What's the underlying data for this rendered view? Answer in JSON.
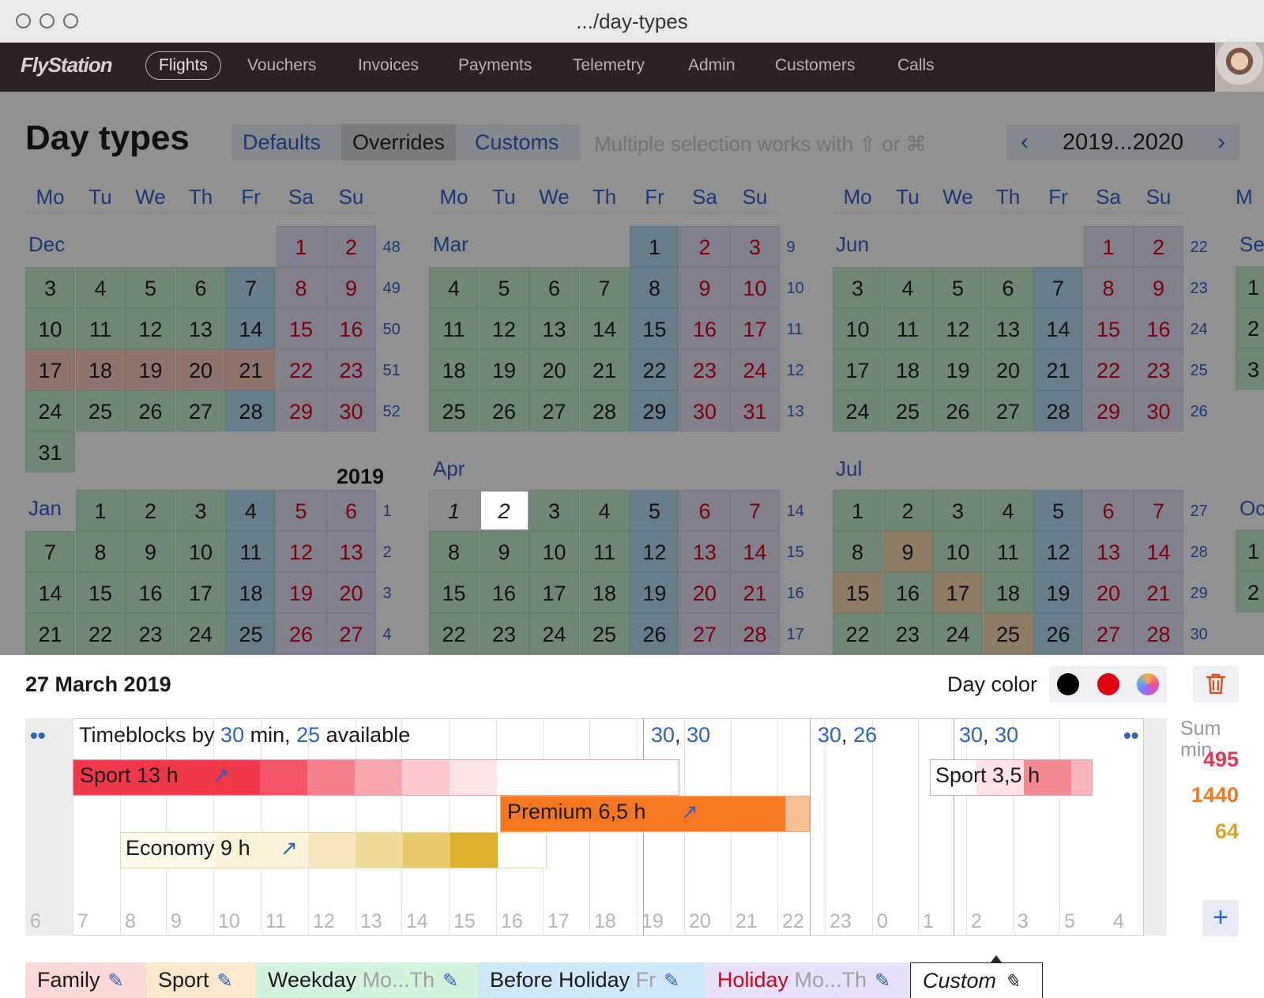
{
  "window": {
    "title": ".../day-types"
  },
  "nav": {
    "logo": "FlyStation",
    "items": [
      {
        "label": "Flights",
        "active": true
      },
      {
        "label": "Vouchers"
      },
      {
        "label": "Invoices"
      },
      {
        "label": "Payments"
      },
      {
        "label": "Telemetry"
      },
      {
        "label": "Admin"
      },
      {
        "label": "Customers"
      },
      {
        "label": "Calls"
      }
    ]
  },
  "page": {
    "title": "Day types",
    "tabs": [
      "Defaults",
      "Overrides",
      "Customs"
    ],
    "selected_tab": "Overrides",
    "hint": "Multiple selection works with ⇧ or ⌘",
    "year_range": "2019...2020",
    "prev_icon": "chevron-left-icon",
    "next_icon": "chevron-right-icon"
  },
  "calendar": {
    "weekdays": [
      "Mo",
      "Tu",
      "We",
      "Th",
      "Fr",
      "Sa",
      "Su"
    ],
    "year_label": "2019",
    "months": [
      "Dec",
      "Mar",
      "Jun",
      "Se",
      "Jan",
      "Apr",
      "Jul",
      "Oc"
    ],
    "col1": {
      "dec": {
        "rows": [
          [
            "",
            "",
            "",
            "",
            "",
            "1",
            "2"
          ],
          [
            "3",
            "4",
            "5",
            "6",
            "7",
            "8",
            "9"
          ],
          [
            "10",
            "11",
            "12",
            "13",
            "14",
            "15",
            "16"
          ],
          [
            "17",
            "18",
            "19",
            "20",
            "21",
            "22",
            "23"
          ],
          [
            "24",
            "25",
            "26",
            "27",
            "28",
            "29",
            "30"
          ],
          [
            "31",
            "",
            "",
            "",
            "",
            "",
            ""
          ]
        ],
        "weeks": [
          "48",
          "49",
          "50",
          "51",
          "52"
        ]
      },
      "jan": {
        "rows": [
          [
            "",
            "1",
            "2",
            "3",
            "4",
            "5",
            "6"
          ],
          [
            "7",
            "8",
            "9",
            "10",
            "11",
            "12",
            "13"
          ],
          [
            "14",
            "15",
            "16",
            "17",
            "18",
            "19",
            "20"
          ],
          [
            "21",
            "22",
            "23",
            "24",
            "25",
            "26",
            "27"
          ]
        ],
        "weeks": [
          "1",
          "2",
          "3",
          "4"
        ]
      }
    },
    "col2": {
      "mar": {
        "rows": [
          [
            "",
            "",
            "",
            "",
            "1",
            "2",
            "3"
          ],
          [
            "4",
            "5",
            "6",
            "7",
            "8",
            "9",
            "10"
          ],
          [
            "11",
            "12",
            "13",
            "14",
            "15",
            "16",
            "17"
          ],
          [
            "18",
            "19",
            "20",
            "21",
            "22",
            "23",
            "24"
          ],
          [
            "25",
            "26",
            "27",
            "28",
            "29",
            "30",
            "31"
          ]
        ],
        "weeks": [
          "9",
          "10",
          "11",
          "12",
          "13"
        ]
      },
      "apr": {
        "rows": [
          [
            "1",
            "2",
            "3",
            "4",
            "5",
            "6",
            "7"
          ],
          [
            "8",
            "9",
            "10",
            "11",
            "12",
            "13",
            "14"
          ],
          [
            "15",
            "16",
            "17",
            "18",
            "19",
            "20",
            "21"
          ],
          [
            "22",
            "23",
            "24",
            "25",
            "26",
            "27",
            "28"
          ]
        ],
        "weeks": [
          "14",
          "15",
          "16",
          "17"
        ]
      }
    },
    "col3": {
      "jun": {
        "rows": [
          [
            "",
            "",
            "",
            "",
            "",
            "1",
            "2"
          ],
          [
            "3",
            "4",
            "5",
            "6",
            "7",
            "8",
            "9"
          ],
          [
            "10",
            "11",
            "12",
            "13",
            "14",
            "15",
            "16"
          ],
          [
            "17",
            "18",
            "19",
            "20",
            "21",
            "22",
            "23"
          ],
          [
            "24",
            "25",
            "26",
            "27",
            "28",
            "29",
            "30"
          ]
        ],
        "weeks": [
          "22",
          "23",
          "24",
          "25",
          "26"
        ]
      },
      "jul": {
        "rows": [
          [
            "1",
            "2",
            "3",
            "4",
            "5",
            "6",
            "7"
          ],
          [
            "8",
            "9",
            "10",
            "11",
            "12",
            "13",
            "14"
          ],
          [
            "15",
            "16",
            "17",
            "18",
            "19",
            "20",
            "21"
          ],
          [
            "22",
            "23",
            "24",
            "25",
            "26",
            "27",
            "28"
          ]
        ],
        "weeks": [
          "27",
          "28",
          "29",
          "30"
        ]
      }
    },
    "col4_partial": [
      "1",
      "2",
      "3",
      "1",
      "2"
    ]
  },
  "editor": {
    "date": "27 March 2019",
    "day_color_label": "Day color",
    "colors": [
      "#000000",
      "#e0000f",
      "gradient"
    ],
    "trash_icon": "trash-icon",
    "timeblocks": {
      "prefix": "Timeblocks by ",
      "by": "30",
      "mid": " min, ",
      "available": "25",
      "suffix": " available"
    },
    "groups": [
      {
        "a": "30",
        "b": "30"
      },
      {
        "a": "30",
        "b": "26"
      },
      {
        "a": "30",
        "b": "30"
      }
    ],
    "comma": ", ",
    "dots": "••",
    "hours": [
      "6",
      "7",
      "8",
      "9",
      "10",
      "11",
      "12",
      "13",
      "14",
      "15",
      "16",
      "17",
      "18",
      "19",
      "20",
      "21",
      "22",
      "23",
      "0",
      "1",
      "2",
      "3",
      "5",
      "4"
    ],
    "bars": [
      {
        "label": "Sport 13 h",
        "color": "#f0384a"
      },
      {
        "label": "Premium 6,5 h",
        "color": "#f5771f"
      },
      {
        "label": "Economy 9 h",
        "color": "#dcae2a"
      },
      {
        "label": "Sport 3,5 h",
        "color": "#f0384a"
      }
    ],
    "ext_icon": "↗",
    "sum_label": "Sum min",
    "sums": [
      {
        "value": "495",
        "color": "#e8394a"
      },
      {
        "value": "1440",
        "color": "#f07a1c"
      },
      {
        "value": "64",
        "color": "#d8a520"
      }
    ],
    "add_label": "+"
  },
  "legend": [
    {
      "label": "Family",
      "sub": "",
      "color": "#fbd9d6"
    },
    {
      "label": "Sport",
      "sub": "",
      "color": "#fce8cc"
    },
    {
      "label": "Weekday",
      "sub": " Mo...Th",
      "color": "#d4f3dc"
    },
    {
      "label": "Before Holiday",
      "sub": " Fr",
      "color": "#cfe9fa"
    },
    {
      "label": "Holiday",
      "sub": " Mo...Th",
      "color": "#e7e1fb"
    },
    {
      "label": "Custom",
      "sub": "",
      "color": "#ffffff"
    }
  ],
  "pencil_icon": "✎"
}
